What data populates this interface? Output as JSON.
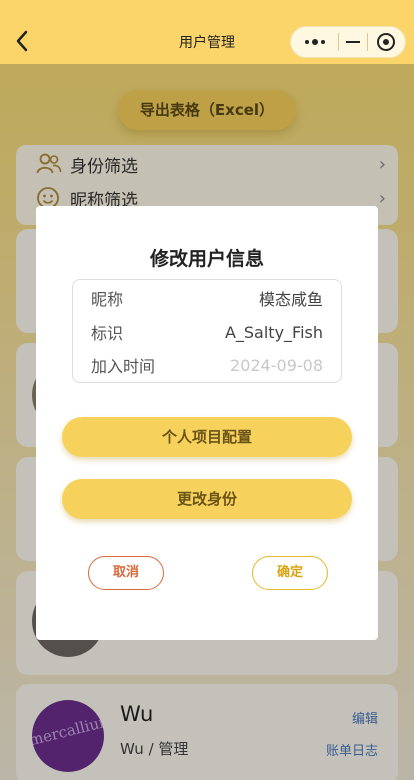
{
  "navbar": {
    "title": "用户管理"
  },
  "page": {
    "export_label": "导出表格（Excel）",
    "filters": [
      {
        "label": "身份筛选",
        "icon": "people-icon"
      },
      {
        "label": "昵称筛选",
        "icon": "smiley-icon"
      }
    ],
    "user_card": {
      "avatar_text": "mercalliureAI",
      "name": "Wu",
      "subtitle": "Wu / 管理",
      "edit_label": "编辑",
      "log_label": "账单日志"
    }
  },
  "modal": {
    "title": "修改用户信息",
    "fields": [
      {
        "key": "昵称",
        "value": "模态咸鱼"
      },
      {
        "key": "标识",
        "value": "A_Salty_Fish"
      },
      {
        "key": "加入时间",
        "value": "2024-09-08"
      }
    ],
    "project_config_label": "个人项目配置",
    "change_role_label": "更改身份",
    "cancel_label": "取消",
    "confirm_label": "确定"
  },
  "colors": {
    "accent": "#fbd56a",
    "button": "#f6d25c",
    "cancel": "#d9683a",
    "confirm": "#e6b82a",
    "link": "#4a78b8"
  }
}
